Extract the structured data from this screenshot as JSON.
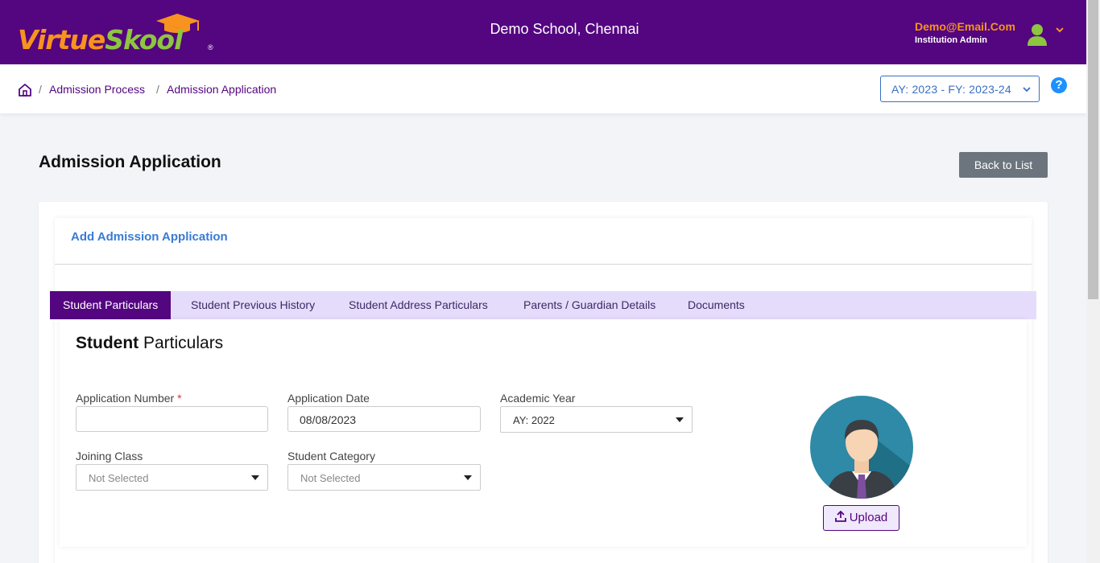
{
  "header": {
    "logo_virtue": "Virtue",
    "logo_skool": "Skool",
    "logo_reg": "®",
    "school_name": "Demo School, Chennai",
    "user_email": "Demo@Email.Com",
    "user_role": "Institution Admin"
  },
  "breadcrumb": {
    "items": [
      "Admission Process",
      "Admission Application"
    ],
    "separator": "/"
  },
  "year_select": {
    "value": "AY: 2023 - FY: 2023-24"
  },
  "help_label": "?",
  "page": {
    "title": "Admission Application",
    "back_label": "Back to List",
    "card_title": "Add Admission Application"
  },
  "tabs": [
    {
      "label": "Student Particulars",
      "active": true
    },
    {
      "label": "Student Previous History",
      "active": false
    },
    {
      "label": "Student Address Particulars",
      "active": false
    },
    {
      "label": "Parents / Guardian Details",
      "active": false
    },
    {
      "label": "Documents",
      "active": false
    }
  ],
  "section": {
    "title_bold": "Student",
    "title_rest": " Particulars"
  },
  "form": {
    "application_number": {
      "label": "Application Number",
      "required_mark": "*",
      "value": ""
    },
    "application_date": {
      "label": "Application Date",
      "value": "08/08/2023"
    },
    "academic_year": {
      "label": "Academic Year",
      "value": "AY: 2022"
    },
    "joining_class": {
      "label": "Joining Class",
      "value": "Not Selected"
    },
    "student_category": {
      "label": "Student Category",
      "value": "Not Selected"
    }
  },
  "upload_label": "Upload",
  "colors": {
    "brand_purple": "#540580",
    "logo_orange": "#f7931e",
    "logo_green": "#8dc63f",
    "tab_bg": "#e5dcfc",
    "link_blue": "#3a7bd5",
    "secondary_button": "#6c757d"
  },
  "icons": [
    "graduation-cap-icon",
    "user-avatar-icon",
    "chevron-down-icon",
    "home-icon",
    "help-icon",
    "caret-down-icon",
    "student-photo-icon",
    "upload-icon"
  ]
}
